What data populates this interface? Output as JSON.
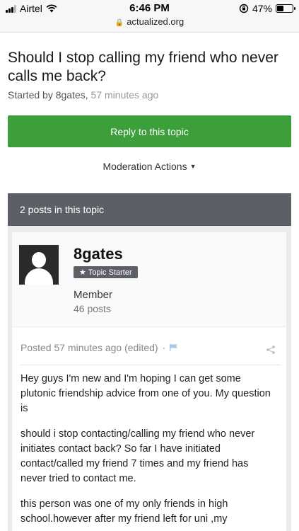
{
  "status_bar": {
    "carrier": "Airtel",
    "time": "6:46 PM",
    "battery": "47%",
    "battery_level": 0.47
  },
  "browser": {
    "url": "actualized.org"
  },
  "topic": {
    "title": "Should I stop calling my friend who never calls me back?",
    "started_by_prefix": "Started by",
    "author": "8gates,",
    "time": "57 minutes ago"
  },
  "actions": {
    "reply": "Reply to this topic",
    "moderation": "Moderation Actions"
  },
  "posts_header": "2 posts in this topic",
  "post": {
    "username": "8gates",
    "badge": "Topic Starter",
    "role": "Member",
    "post_count": "46 posts",
    "meta": "Posted 57 minutes ago (edited)",
    "separator": "·",
    "paragraphs": [
      "Hey guys I'm new and I'm hoping I can get some plutonic friendship advice from one of you. My question is",
      "should i stop contacting/calling my friend who never initiates contact back? So far I have initiated contact/called my friend 7 times and my friend has never tried to contact me.",
      "this person was one of my only friends in high school.however after my friend left for uni ,my"
    ]
  },
  "colors": {
    "reply_button": "#3d9f3b",
    "header_bar": "#5c6066",
    "flag": "#a8c6e8"
  },
  "icons": [
    "signal-icon",
    "wifi-icon",
    "lock-icon",
    "orientation-lock-icon",
    "battery-icon",
    "caret-down-icon",
    "star-icon",
    "flag-icon",
    "share-icon"
  ]
}
